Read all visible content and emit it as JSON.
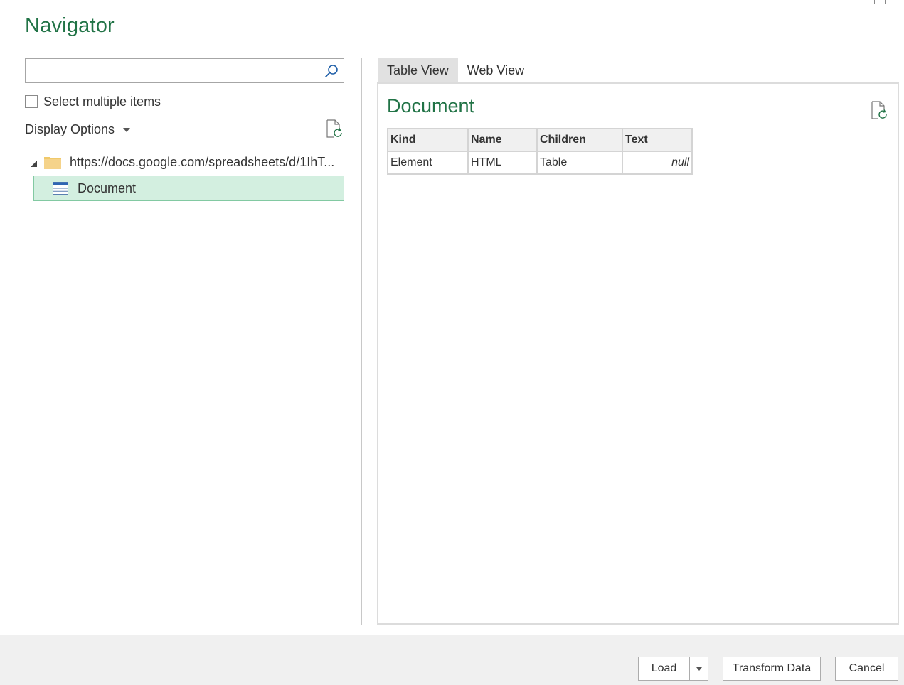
{
  "window": {
    "title": "Navigator"
  },
  "search": {
    "value": "",
    "placeholder": "",
    "icon": "search-icon"
  },
  "select_multiple": {
    "label": "Select multiple items",
    "checked": false
  },
  "display_options": {
    "label": "Display Options"
  },
  "tree": {
    "root": {
      "label": "https://docs.google.com/spreadsheets/d/1IhT...",
      "icon": "folder-icon",
      "expanded": true
    },
    "children": [
      {
        "label": "Document",
        "icon": "table-icon",
        "selected": true
      }
    ]
  },
  "tabs": [
    {
      "label": "Table View",
      "active": true
    },
    {
      "label": "Web View",
      "active": false
    }
  ],
  "preview": {
    "title": "Document",
    "columns": [
      "Kind",
      "Name",
      "Children",
      "Text"
    ],
    "rows": [
      [
        "Element",
        "HTML",
        "Table",
        "null"
      ]
    ]
  },
  "buttons": {
    "load": "Load",
    "transform": "Transform Data",
    "cancel": "Cancel"
  },
  "colors": {
    "accent": "#217346",
    "selection_bg": "#d3efe0",
    "selection_border": "#82c9a2",
    "footer_bg": "#f0f0f0"
  }
}
